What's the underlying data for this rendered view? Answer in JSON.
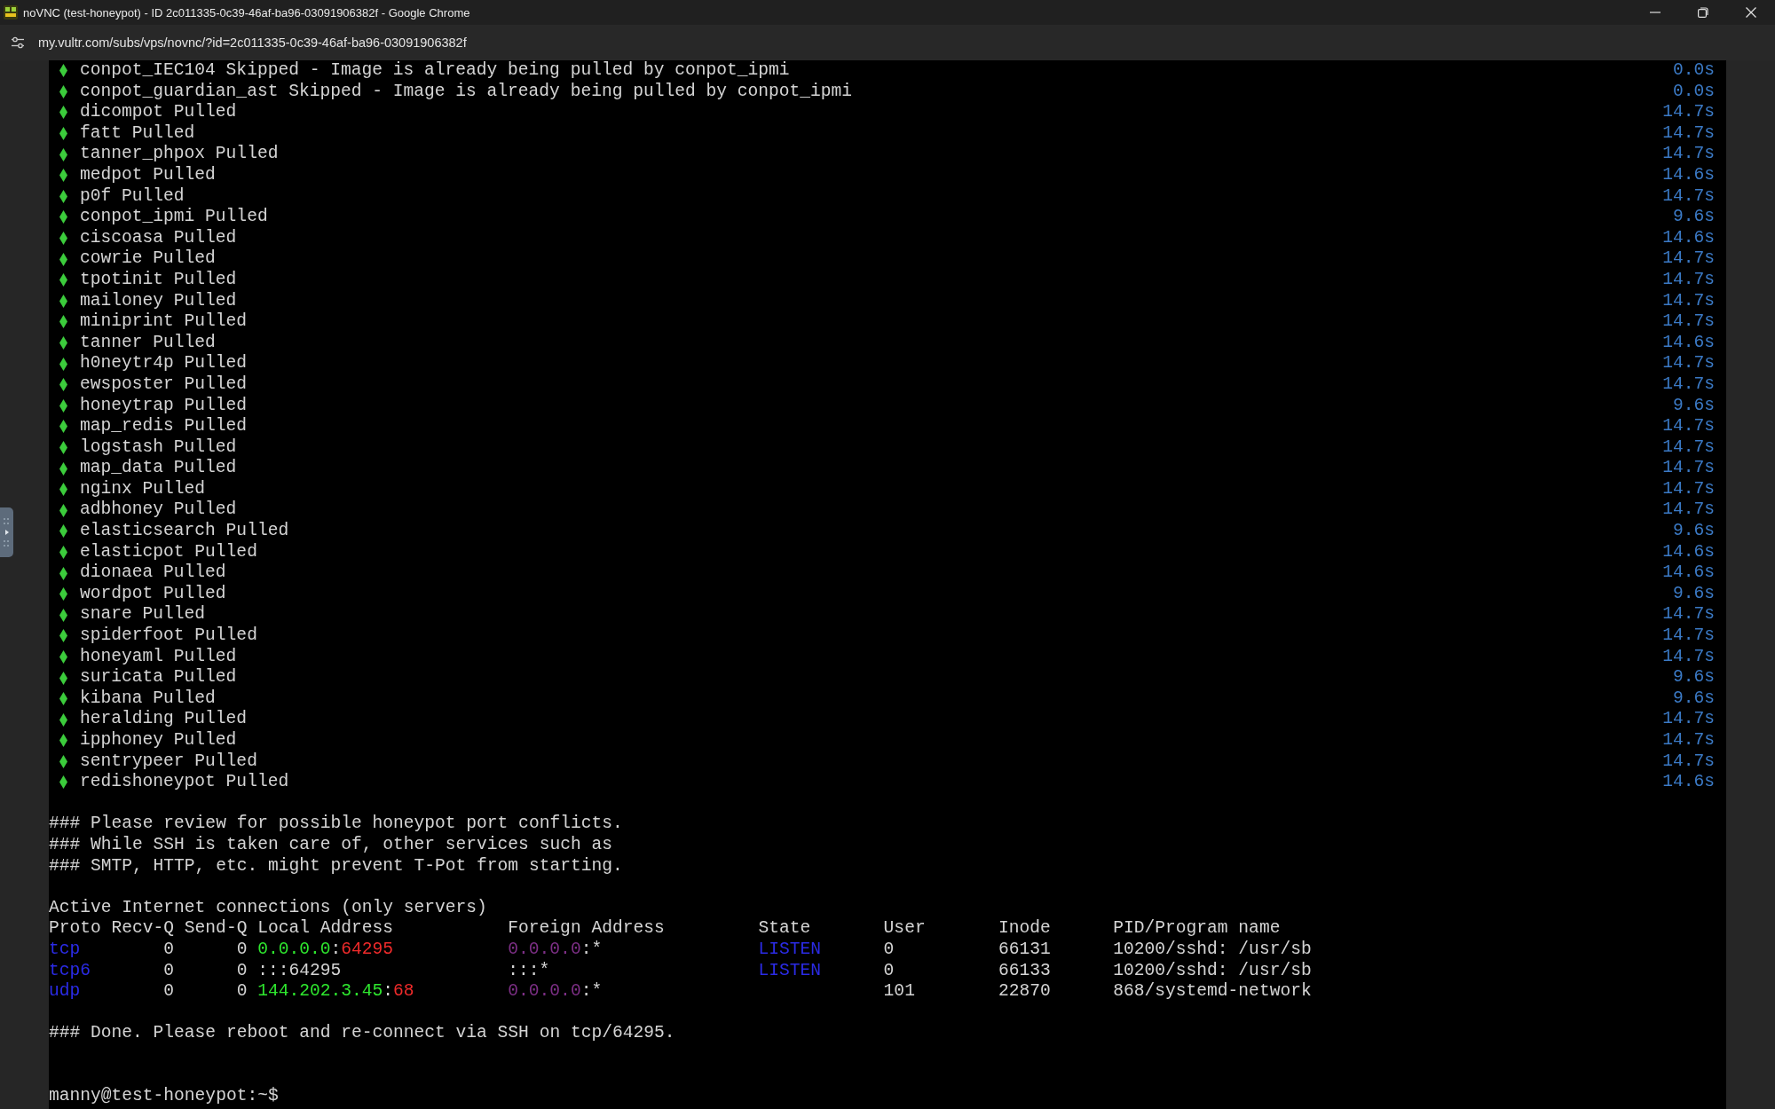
{
  "window": {
    "title": "noVNC (test-honeypot) - ID 2c011335-0c39-46af-ba96-03091906382f - Google Chrome"
  },
  "address_bar": {
    "url": "my.vultr.com/subs/vps/novnc/?id=2c011335-0c39-46af-ba96-03091906382f"
  },
  "terminal": {
    "pull_lines": [
      {
        "text": "conpot_IEC104 Skipped - Image is already being pulled by conpot_ipmi",
        "time": "0.0s"
      },
      {
        "text": "conpot_guardian_ast Skipped - Image is already being pulled by conpot_ipmi",
        "time": "0.0s"
      },
      {
        "text": "dicompot Pulled",
        "time": "14.7s"
      },
      {
        "text": "fatt Pulled",
        "time": "14.7s"
      },
      {
        "text": "tanner_phpox Pulled",
        "time": "14.7s"
      },
      {
        "text": "medpot Pulled",
        "time": "14.6s"
      },
      {
        "text": "p0f Pulled",
        "time": "14.7s"
      },
      {
        "text": "conpot_ipmi Pulled",
        "time": "9.6s"
      },
      {
        "text": "ciscoasa Pulled",
        "time": "14.6s"
      },
      {
        "text": "cowrie Pulled",
        "time": "14.7s"
      },
      {
        "text": "tpotinit Pulled",
        "time": "14.7s"
      },
      {
        "text": "mailoney Pulled",
        "time": "14.7s"
      },
      {
        "text": "miniprint Pulled",
        "time": "14.7s"
      },
      {
        "text": "tanner Pulled",
        "time": "14.6s"
      },
      {
        "text": "h0neytr4p Pulled",
        "time": "14.7s"
      },
      {
        "text": "ewsposter Pulled",
        "time": "14.7s"
      },
      {
        "text": "honeytrap Pulled",
        "time": "9.6s"
      },
      {
        "text": "map_redis Pulled",
        "time": "14.7s"
      },
      {
        "text": "logstash Pulled",
        "time": "14.7s"
      },
      {
        "text": "map_data Pulled",
        "time": "14.7s"
      },
      {
        "text": "nginx Pulled",
        "time": "14.7s"
      },
      {
        "text": "adbhoney Pulled",
        "time": "14.7s"
      },
      {
        "text": "elasticsearch Pulled",
        "time": "9.6s"
      },
      {
        "text": "elasticpot Pulled",
        "time": "14.6s"
      },
      {
        "text": "dionaea Pulled",
        "time": "14.6s"
      },
      {
        "text": "wordpot Pulled",
        "time": "9.6s"
      },
      {
        "text": "snare Pulled",
        "time": "14.7s"
      },
      {
        "text": "spiderfoot Pulled",
        "time": "14.7s"
      },
      {
        "text": "honeyaml Pulled",
        "time": "14.7s"
      },
      {
        "text": "suricata Pulled",
        "time": "9.6s"
      },
      {
        "text": "kibana Pulled",
        "time": "9.6s"
      },
      {
        "text": "heralding Pulled",
        "time": "14.7s"
      },
      {
        "text": "ipphoney Pulled",
        "time": "14.7s"
      },
      {
        "text": "sentrypeer Pulled",
        "time": "14.7s"
      },
      {
        "text": "redishoneypot Pulled",
        "time": "14.6s"
      }
    ],
    "notice_lines": [
      "### Please review for possible honeypot port conflicts.",
      "### While SSH is taken care of, other services such as",
      "### SMTP, HTTP, etc. might prevent T-Pot from starting."
    ],
    "netstat": {
      "title": "Active Internet connections (only servers)",
      "columns": [
        "Proto",
        "Recv-Q",
        "Send-Q",
        "Local Address",
        "Foreign Address",
        "State",
        "User",
        "Inode",
        "PID/Program name"
      ],
      "rows": [
        {
          "proto": "tcp",
          "recv_q": "0",
          "send_q": "0",
          "local_address": [
            {
              "kind": "local-host",
              "text": "0.0.0.0"
            },
            {
              "kind": "plain",
              "text": ":"
            },
            {
              "kind": "port",
              "text": "64295"
            }
          ],
          "foreign_address": [
            {
              "kind": "remote-host",
              "text": "0.0.0.0"
            },
            {
              "kind": "plain",
              "text": ":*"
            }
          ],
          "state": "LISTEN",
          "user": "0",
          "inode": "66131",
          "program": "10200/sshd: /usr/sb"
        },
        {
          "proto": "tcp6",
          "recv_q": "0",
          "send_q": "0",
          "local_address": [
            {
              "kind": "plain",
              "text": ":::64295"
            }
          ],
          "foreign_address": [
            {
              "kind": "plain",
              "text": ":::*"
            }
          ],
          "state": "LISTEN",
          "user": "0",
          "inode": "66133",
          "program": "10200/sshd: /usr/sb"
        },
        {
          "proto": "udp",
          "recv_q": "0",
          "send_q": "0",
          "local_address": [
            {
              "kind": "local-host",
              "text": "144.202.3.45"
            },
            {
              "kind": "plain",
              "text": ":"
            },
            {
              "kind": "port",
              "text": "68"
            }
          ],
          "foreign_address": [
            {
              "kind": "remote-host",
              "text": "0.0.0.0"
            },
            {
              "kind": "plain",
              "text": ":*"
            }
          ],
          "user": "101",
          "inode": "22870",
          "program": "868/systemd-network"
        }
      ]
    },
    "done_line": "### Done. Please reboot and re-connect via SSH on tcp/64295.",
    "prompt": "manny@test-honeypot:~$"
  }
}
